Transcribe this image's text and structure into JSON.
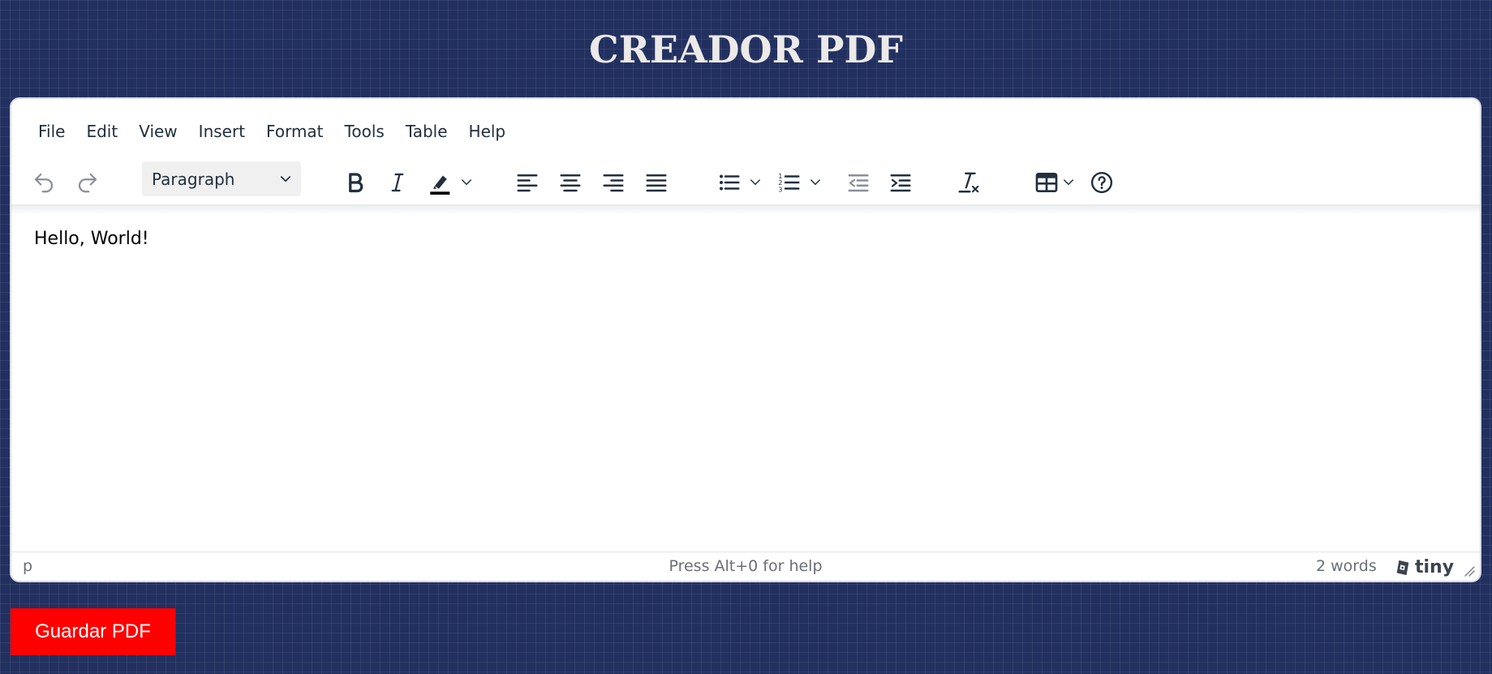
{
  "app": {
    "title": "CREADOR PDF"
  },
  "menubar": {
    "items": [
      {
        "label": "File"
      },
      {
        "label": "Edit"
      },
      {
        "label": "View"
      },
      {
        "label": "Insert"
      },
      {
        "label": "Format"
      },
      {
        "label": "Tools"
      },
      {
        "label": "Table"
      },
      {
        "label": "Help"
      }
    ]
  },
  "toolbar": {
    "block_format": "Paragraph",
    "icons": [
      "undo-icon",
      "redo-icon",
      "bold-icon",
      "italic-icon",
      "highlight-icon",
      "align-left-icon",
      "align-center-icon",
      "align-right-icon",
      "align-justify-icon",
      "bullet-list-icon",
      "numbered-list-icon",
      "outdent-icon",
      "indent-icon",
      "clear-formatting-icon",
      "table-icon",
      "help-icon"
    ],
    "highlight_color": "#000000"
  },
  "editor": {
    "content": "Hello, World!"
  },
  "statusbar": {
    "path": "p",
    "help_text": "Press Alt+0 for help",
    "word_count": "2 words",
    "brand": "tiny"
  },
  "actions": {
    "save_label": "Guardar PDF"
  },
  "colors": {
    "background": "#223060",
    "title": "#ece9e9",
    "save_button": "#ff0000"
  }
}
